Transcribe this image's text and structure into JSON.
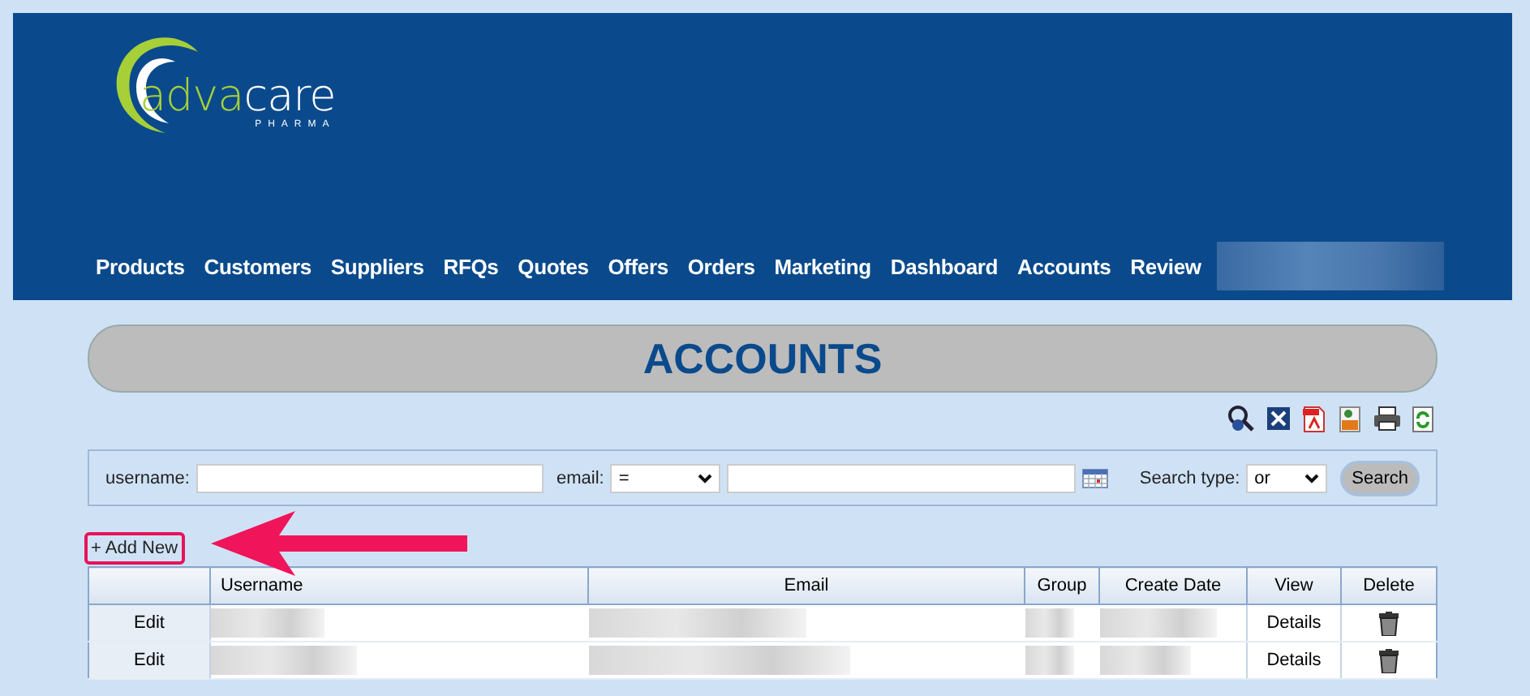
{
  "logo": {
    "parts": [
      {
        "text": "adva",
        "color": "#a6cf38"
      },
      {
        "text": "care",
        "color": "#ffffff"
      }
    ],
    "tagline": "PHARMA"
  },
  "nav": [
    {
      "label": "Products"
    },
    {
      "label": "Customers"
    },
    {
      "label": "Suppliers"
    },
    {
      "label": "RFQs"
    },
    {
      "label": "Quotes"
    },
    {
      "label": "Offers"
    },
    {
      "label": "Orders"
    },
    {
      "label": "Marketing"
    },
    {
      "label": "Dashboard"
    },
    {
      "label": "Accounts"
    },
    {
      "label": "Review"
    }
  ],
  "page_title": "ACCOUNTS",
  "filters": {
    "username_label": "username:",
    "email_label": "email:",
    "email_operator": "=",
    "search_type_label": "Search type:",
    "search_type": "or",
    "search_button": "Search"
  },
  "add_new": "+ Add New",
  "table": {
    "columns": [
      "",
      "Username",
      "Email",
      "Group",
      "Create Date",
      "View",
      "Delete"
    ],
    "rows": [
      {
        "edit": "Edit",
        "view": "Details"
      },
      {
        "edit": "Edit",
        "view": "Details"
      }
    ]
  }
}
